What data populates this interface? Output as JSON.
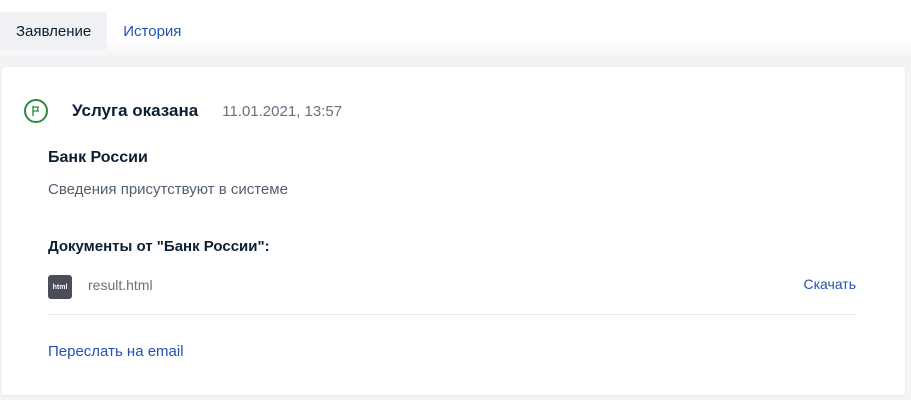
{
  "tabs": [
    {
      "label": "Заявление",
      "active": true
    },
    {
      "label": "История",
      "active": false
    }
  ],
  "status": {
    "icon": "flag-icon",
    "title": "Услуга оказана",
    "date": "11.01.2021, 13:57",
    "color": "#2e8a43"
  },
  "organization": {
    "name": "Банк России",
    "description": "Сведения присутствуют в системе"
  },
  "documents": {
    "title": "Документы от \"Банк России\":",
    "items": [
      {
        "badge": "html",
        "name": "result.html",
        "action_label": "Скачать"
      }
    ]
  },
  "actions": {
    "email_label": "Переслать на email"
  },
  "colors": {
    "link": "#2550b4",
    "text": "#0b1f33",
    "muted": "#66727f"
  }
}
